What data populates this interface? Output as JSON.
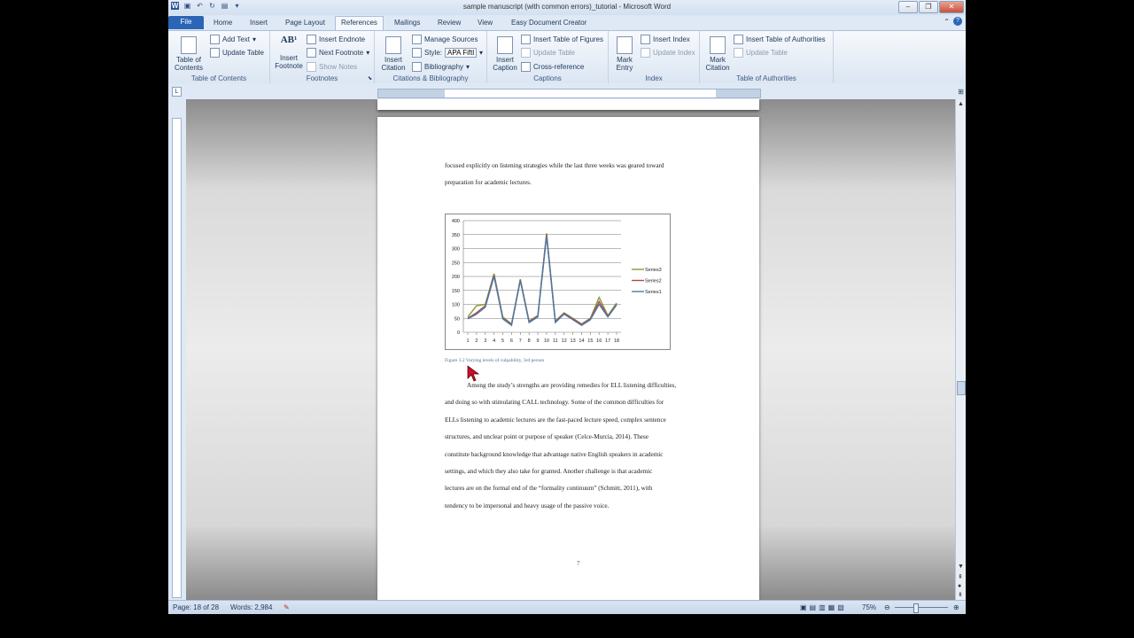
{
  "window": {
    "title": "sample manuscript (with common errors)_tutorial - Microsoft Word"
  },
  "tabs": [
    "File",
    "Home",
    "Insert",
    "Page Layout",
    "References",
    "Mailings",
    "Review",
    "View",
    "Easy Document Creator"
  ],
  "ribbon": {
    "toc": {
      "table_of_contents": "Table of\nContents",
      "add_text": "Add Text",
      "update_table": "Update Table",
      "group": "Table of Contents"
    },
    "footnotes": {
      "insert_footnote": "Insert\nFootnote",
      "insert_endnote": "Insert Endnote",
      "next_footnote": "Next Footnote",
      "show_notes": "Show Notes",
      "group": "Footnotes"
    },
    "citations": {
      "insert_citation": "Insert\nCitation",
      "manage_sources": "Manage Sources",
      "style_label": "Style:",
      "style_value": "APA Fiftl",
      "bibliography": "Bibliography",
      "group": "Citations & Bibliography"
    },
    "captions": {
      "insert_caption": "Insert\nCaption",
      "insert_table_of_figures": "Insert Table of Figures",
      "update_table": "Update Table",
      "cross_reference": "Cross-reference",
      "group": "Captions"
    },
    "index": {
      "mark_entry": "Mark\nEntry",
      "insert_index": "Insert Index",
      "update_index": "Update Index",
      "group": "Index"
    },
    "authorities": {
      "mark_citation": "Mark\nCitation",
      "insert_table_of_authorities": "Insert Table of Authorities",
      "update_table": "Update Table",
      "group": "Table of Authorities"
    }
  },
  "document": {
    "para1": [
      "focused explicitly  on listening strategies while the last three weeks was geared toward",
      "preparation  for academic lectures."
    ],
    "caption": "Figure 3.2 Varying levels of culpability, 3rd person",
    "para2": [
      "Among the study’s strengths are providing remedies for ELL listening difficulties,",
      "and doing so with stimulating CALL technology.  Some of the common difficulties for",
      "ELLs listening to academic lectures are the fast-paced lecture speed, complex sentence",
      "structures, and unclear point or purpose of speaker (Celce-Murcia, 2014). These",
      "constitute background knowledge that advantage native English speakers in academic",
      "settings, and which they also take for granted. Another challenge is that academic",
      "lectures are on the formal end of the “formality continuum” (Schmitt, 2011), with",
      "tendency to be impersonal and heavy usage of the passive voice."
    ],
    "page_number": "7"
  },
  "chart_data": {
    "type": "line",
    "categories": [
      "1",
      "2",
      "3",
      "4",
      "5",
      "6",
      "7",
      "8",
      "9",
      "10",
      "11",
      "12",
      "13",
      "14",
      "15",
      "16",
      "17",
      "18"
    ],
    "ylim": [
      0,
      400
    ],
    "yticks": [
      "0",
      "50",
      "100",
      "150",
      "200",
      "250",
      "300",
      "350",
      "400"
    ],
    "legend": "right",
    "series": [
      {
        "name": "Series3",
        "color": "#8a9a3c",
        "values": [
          55,
          95,
          100,
          210,
          55,
          30,
          190,
          40,
          60,
          355,
          40,
          70,
          50,
          30,
          50,
          125,
          60,
          105
        ]
      },
      {
        "name": "Series2",
        "color": "#b04a4a",
        "values": [
          50,
          70,
          95,
          205,
          50,
          28,
          188,
          38,
          58,
          350,
          38,
          68,
          48,
          28,
          48,
          110,
          58,
          100
        ]
      },
      {
        "name": "Series1",
        "color": "#4a7aa8",
        "values": [
          48,
          65,
          90,
          200,
          48,
          25,
          185,
          35,
          55,
          345,
          35,
          65,
          45,
          25,
          45,
          100,
          55,
          98
        ]
      }
    ]
  },
  "status": {
    "page": "Page: 18 of 28",
    "words": "Words: 2,984",
    "zoom": "75%"
  }
}
